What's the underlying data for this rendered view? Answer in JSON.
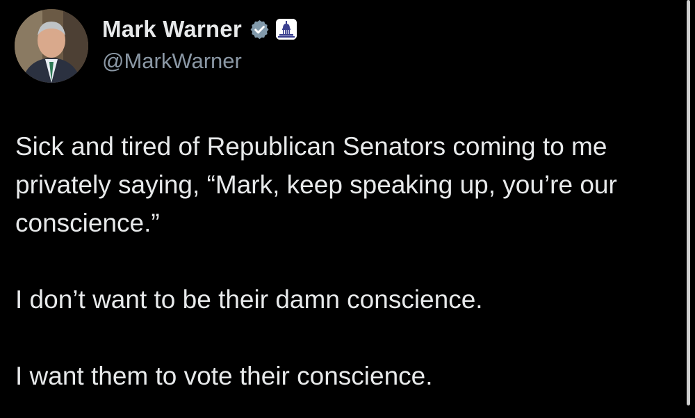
{
  "author": {
    "display_name": "Mark Warner",
    "handle": "@MarkWarner",
    "verified_icon": "verified-badge-icon",
    "affiliation_icon": "capitol-building-icon"
  },
  "tweet": {
    "paragraphs": [
      "Sick and tired of Republican Senators coming to me privately saying, “Mark, keep speaking up, you’re our conscience.”",
      "I don’t want to be their damn conscience.",
      "I want them to vote their conscience."
    ]
  },
  "colors": {
    "background": "#000000",
    "text_primary": "#e7e9ea",
    "text_secondary": "#8b98a5",
    "verified_badge": "#829aab",
    "gov_badge_background": "#ffffff",
    "gov_badge_icon": "#3a3f8f"
  }
}
